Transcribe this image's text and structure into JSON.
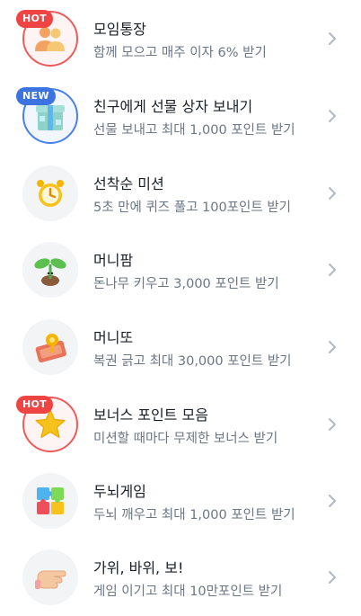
{
  "items": [
    {
      "title": "모임통장",
      "subtitle": "함께 모으고 매주 이자 6% 받기",
      "badge": "HOT",
      "icon": "people-icon"
    },
    {
      "title": "친구에게 선물 상자 보내기",
      "subtitle": "선물 보내고 최대 1,000 포인트 받기",
      "badge": "NEW",
      "icon": "gift-box-icon"
    },
    {
      "title": "선착순 미션",
      "subtitle": "5초 만에 퀴즈 풀고 100포인트 받기",
      "badge": "",
      "icon": "alarm-clock-icon"
    },
    {
      "title": "머니팜",
      "subtitle": "돈나무 키우고 3,000 포인트 받기",
      "badge": "",
      "icon": "sprout-icon"
    },
    {
      "title": "머니또",
      "subtitle": "복권 긁고 최대 30,000 포인트 받기",
      "badge": "",
      "icon": "lottery-ticket-icon"
    },
    {
      "title": "보너스 포인트 모음",
      "subtitle": "미션할 때마다 무제한 보너스 받기",
      "badge": "HOT",
      "icon": "star-icon"
    },
    {
      "title": "두뇌게임",
      "subtitle": "두뇌 깨우고 최대 1,000 포인트 받기",
      "badge": "",
      "icon": "puzzle-icon"
    },
    {
      "title": "가위, 바위, 보!",
      "subtitle": "게임 이기고 최대 10만포인트 받기",
      "badge": "",
      "icon": "hand-icon"
    }
  ],
  "colors": {
    "hot": "#ef4444",
    "new": "#3b74e0",
    "title": "#191f28",
    "subtitle": "#6b7684",
    "chevron": "#b0b8c1"
  }
}
